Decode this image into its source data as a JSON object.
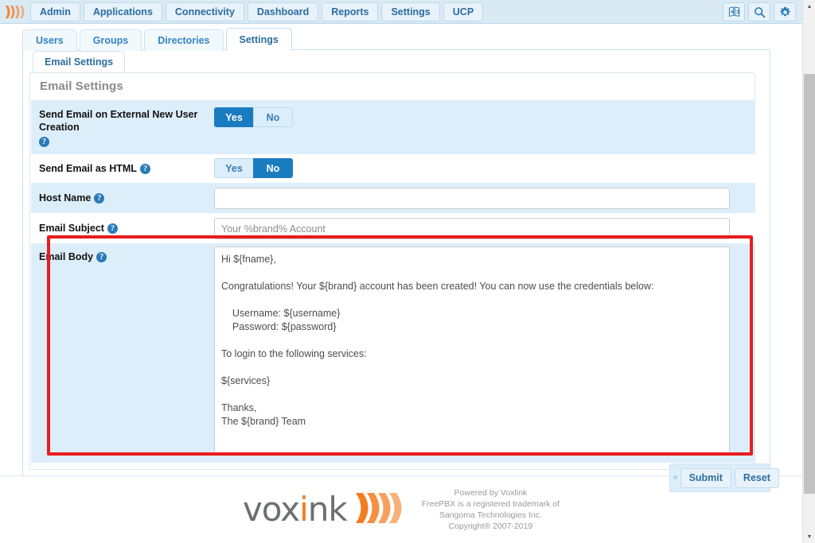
{
  "navbar": {
    "logo_icon": "voxlink-waves-icon",
    "items": [
      {
        "label": "Admin",
        "name": "nav-item-admin"
      },
      {
        "label": "Applications",
        "name": "nav-item-applications"
      },
      {
        "label": "Connectivity",
        "name": "nav-item-connectivity"
      },
      {
        "label": "Dashboard",
        "name": "nav-item-dashboard"
      },
      {
        "label": "Reports",
        "name": "nav-item-reports"
      },
      {
        "label": "Settings",
        "name": "nav-item-settings"
      },
      {
        "label": "UCP",
        "name": "nav-item-ucp"
      }
    ],
    "right_icons": [
      {
        "name": "language-translate-icon"
      },
      {
        "name": "search-icon"
      },
      {
        "name": "gear-icon"
      }
    ]
  },
  "tabs_primary": [
    {
      "label": "Users",
      "active": false
    },
    {
      "label": "Groups",
      "active": false
    },
    {
      "label": "Directories",
      "active": false
    },
    {
      "label": "Settings",
      "active": true
    }
  ],
  "tabs_secondary": [
    {
      "label": "Email Settings",
      "active": true
    }
  ],
  "panel": {
    "heading": "Email Settings"
  },
  "form": {
    "rows": [
      {
        "label": "Send Email on External New User Creation",
        "help_icon": "help-circle-icon",
        "type": "toggle",
        "options": [
          "Yes",
          "No"
        ],
        "value": "Yes"
      },
      {
        "label": "Send Email as HTML",
        "help_icon": "help-circle-icon",
        "type": "toggle",
        "options": [
          "Yes",
          "No"
        ],
        "value": "No"
      },
      {
        "label": "Host Name",
        "help_icon": "help-circle-icon",
        "type": "text",
        "value": "",
        "placeholder": ""
      },
      {
        "label": "Email Subject",
        "help_icon": "help-circle-icon",
        "type": "text",
        "value": "",
        "placeholder": "Your %brand% Account"
      },
      {
        "label": "Email Body",
        "help_icon": "help-circle-icon",
        "type": "textarea",
        "value": "Hi ${fname},\n\nCongratulations! Your ${brand} account has been created! You can now use the credentials below:\n\n    Username: ${username}\n    Password: ${password}\n\nTo login to the following services:\n\n${services}\n\nThanks,\nThe ${brand} Team"
      }
    ]
  },
  "actions": {
    "collapse_caret": "«",
    "submit_label": "Submit",
    "reset_label": "Reset"
  },
  "annotation": {
    "highlight_color": "#e81d1d",
    "target": "Email Body"
  },
  "footer": {
    "logo_prefix": "vox",
    "logo_accent": "i",
    "logo_suffix": "nk",
    "logo_icon": "voxlink-waves-icon",
    "lines": [
      "Powered by Voxlink",
      "FreePBX is a registered trademark of",
      "Sangoma Technologies Inc.",
      "Copyright® 2007-2019"
    ]
  },
  "scrollbar": {
    "up_arrow": "▲",
    "down_arrow": "▼"
  }
}
